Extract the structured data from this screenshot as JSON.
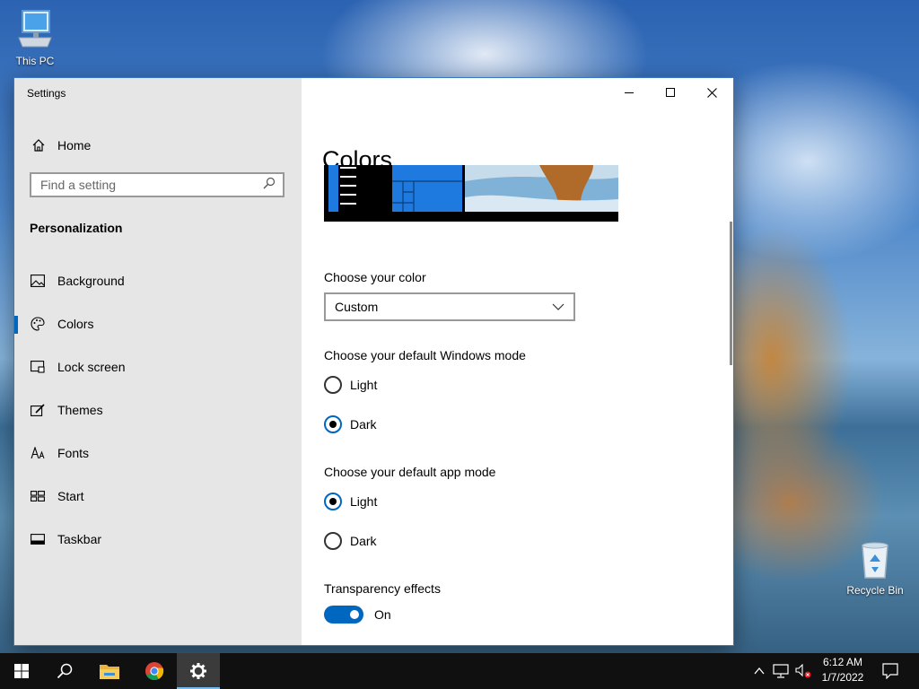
{
  "desktop": {
    "icons": [
      {
        "label": "This PC",
        "icon": "monitor-icon"
      },
      {
        "label": "Recycle Bin",
        "icon": "recycle-bin-icon"
      }
    ]
  },
  "window": {
    "title": "Settings",
    "controls": [
      "minimize",
      "maximize",
      "close"
    ]
  },
  "sidebar": {
    "home_label": "Home",
    "search_placeholder": "Find a setting",
    "section_title": "Personalization",
    "items": [
      {
        "label": "Background",
        "icon": "picture-icon"
      },
      {
        "label": "Colors",
        "icon": "palette-icon",
        "active": true
      },
      {
        "label": "Lock screen",
        "icon": "lock-screen-icon"
      },
      {
        "label": "Themes",
        "icon": "brush-icon"
      },
      {
        "label": "Fonts",
        "icon": "font-icon"
      },
      {
        "label": "Start",
        "icon": "start-icon"
      },
      {
        "label": "Taskbar",
        "icon": "taskbar-icon"
      }
    ]
  },
  "main": {
    "title": "Colors",
    "choose_color_label": "Choose your color",
    "choose_color_value": "Custom",
    "windows_mode_label": "Choose your default Windows mode",
    "windows_mode_options": [
      "Light",
      "Dark"
    ],
    "windows_mode_selected": "Dark",
    "app_mode_label": "Choose your default app mode",
    "app_mode_options": [
      "Light",
      "Dark"
    ],
    "app_mode_selected": "Light",
    "transparency_label": "Transparency effects",
    "transparency_state": "On"
  },
  "taskbar": {
    "apps": [
      "start-icon",
      "search-icon",
      "file-explorer-icon",
      "chrome-icon",
      "settings-icon"
    ],
    "active_app": "settings-icon",
    "time": "6:12 AM",
    "date": "1/7/2022"
  },
  "colors": {
    "accent": "#0067c0",
    "sidebar_bg": "#e6e6e6",
    "taskbar_bg": "#101010"
  }
}
